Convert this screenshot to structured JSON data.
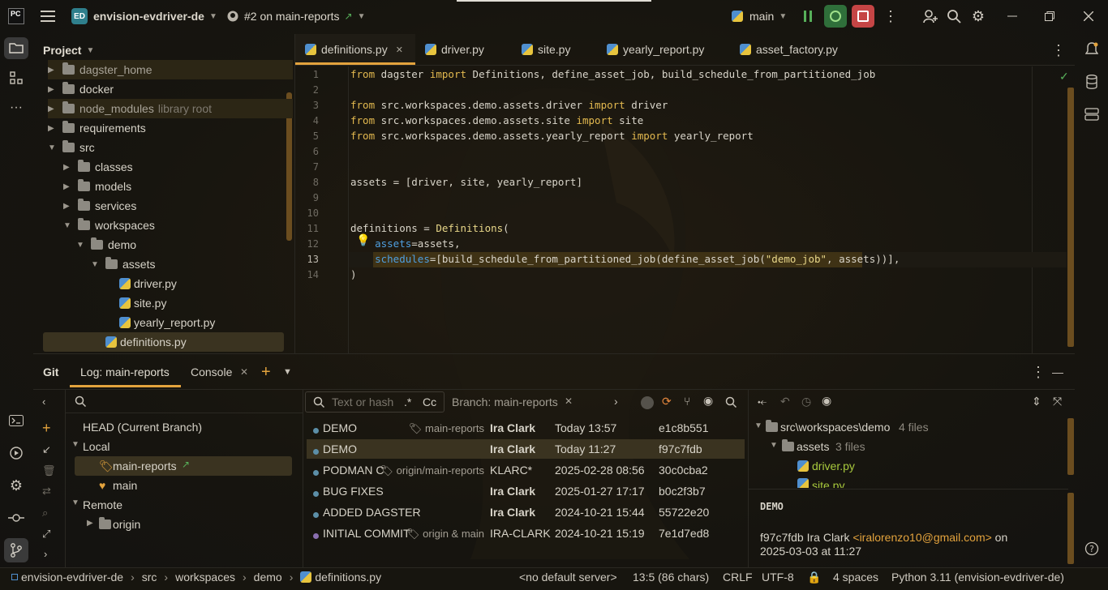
{
  "titlebar": {
    "app_icon": "PC",
    "project_badge": "ED",
    "project_name": "envision-evdriver-de",
    "pr_label": "#2 on main-reports",
    "branch": "main"
  },
  "tree": {
    "header": "Project",
    "items": [
      {
        "label": "dagster_home",
        "kind": "folder",
        "indent": 0,
        "arrow": "right"
      },
      {
        "label": "docker",
        "kind": "folder",
        "indent": 0,
        "arrow": "right"
      },
      {
        "label": "node_modules",
        "kind": "folder",
        "indent": 0,
        "arrow": "right",
        "note": "library root"
      },
      {
        "label": "requirements",
        "kind": "folder",
        "indent": 0,
        "arrow": "right"
      },
      {
        "label": "src",
        "kind": "folder",
        "indent": 0,
        "arrow": "down"
      },
      {
        "label": "classes",
        "kind": "folder",
        "indent": 1,
        "arrow": "right"
      },
      {
        "label": "models",
        "kind": "folder",
        "indent": 1,
        "arrow": "right"
      },
      {
        "label": "services",
        "kind": "folder",
        "indent": 1,
        "arrow": "right"
      },
      {
        "label": "workspaces",
        "kind": "folder",
        "indent": 1,
        "arrow": "down"
      },
      {
        "label": "demo",
        "kind": "folder",
        "indent": 2,
        "arrow": "down"
      },
      {
        "label": "assets",
        "kind": "folder",
        "indent": 3,
        "arrow": "down"
      },
      {
        "label": "driver.py",
        "kind": "py",
        "indent": 4,
        "arrow": ""
      },
      {
        "label": "site.py",
        "kind": "py",
        "indent": 4,
        "arrow": ""
      },
      {
        "label": "yearly_report.py",
        "kind": "py",
        "indent": 4,
        "arrow": ""
      },
      {
        "label": "definitions.py",
        "kind": "py",
        "indent": 3,
        "arrow": ""
      }
    ]
  },
  "editor": {
    "tabs": [
      "definitions.py",
      "driver.py",
      "site.py",
      "yearly_report.py",
      "asset_factory.py"
    ],
    "lines": [
      [
        [
          "kw",
          "from "
        ],
        [
          "",
          "dagster "
        ],
        [
          "kw",
          "import "
        ],
        [
          "",
          "Definitions, define_asset_job, build_schedule_from_partitioned_job"
        ]
      ],
      [],
      [
        [
          "kw",
          "from "
        ],
        [
          "",
          "src.workspaces.demo.assets.driver "
        ],
        [
          "kw",
          "import "
        ],
        [
          "",
          "driver"
        ]
      ],
      [
        [
          "kw",
          "from "
        ],
        [
          "",
          "src.workspaces.demo.assets.site "
        ],
        [
          "kw",
          "import "
        ],
        [
          "",
          "site"
        ]
      ],
      [
        [
          "kw",
          "from "
        ],
        [
          "",
          "src.workspaces.demo.assets.yearly_report "
        ],
        [
          "kw",
          "import "
        ],
        [
          "",
          "yearly_report"
        ]
      ],
      [],
      [],
      [
        [
          "",
          "assets = [driver, site, yearly_report]"
        ]
      ],
      [],
      [],
      [
        [
          "",
          "definitions = "
        ],
        [
          "fn",
          "Definitions"
        ],
        [
          "",
          "("
        ]
      ],
      [
        [
          "",
          "    "
        ],
        [
          "par",
          "assets"
        ],
        [
          "",
          "=assets,"
        ]
      ],
      [
        [
          "",
          "    "
        ],
        [
          "par",
          "schedules"
        ],
        [
          "",
          "=[build_schedule_from_partitioned_job(define_asset_job("
        ],
        [
          "str",
          "\"demo_job\""
        ],
        [
          "",
          ", assets))],"
        ]
      ],
      [
        [
          "",
          ")"
        ]
      ]
    ]
  },
  "bottom": {
    "tabs": [
      "Git",
      "Log: main-reports",
      "Console"
    ],
    "branches": {
      "head": "HEAD (Current Branch)",
      "local": "Local",
      "local_items": [
        "main-reports",
        "main"
      ],
      "remote": "Remote",
      "remote_items": [
        "origin"
      ]
    },
    "filter": {
      "placeholder": "Text or hash",
      "regex": ".*",
      "case": "Cc",
      "branch_label": "Branch: main-reports"
    },
    "commits": [
      {
        "msg": "DEMO",
        "tags": "main-reports",
        "author": "Ira Clark",
        "date": "Today 13:57",
        "hash": "e1c8b551"
      },
      {
        "msg": "DEMO",
        "tags": "",
        "author": "Ira Clark",
        "date": "Today 11:27",
        "hash": "f97c7fdb"
      },
      {
        "msg": "PODMAN C",
        "tags": "origin/main-reports",
        "author": "KLARC*",
        "date": "2025-02-28 08:56",
        "hash": "30c0cba2"
      },
      {
        "msg": "BUG FIXES",
        "tags": "",
        "author": "Ira Clark",
        "date": "2025-01-27 17:17",
        "hash": "b0c2f3b7"
      },
      {
        "msg": "ADDED DAGSTER",
        "tags": "",
        "author": "Ira Clark",
        "date": "2024-10-21 15:44",
        "hash": "55722e20"
      },
      {
        "msg": "INITIAL COMMIT",
        "tags": "origin & main",
        "author": "IRA-CLARK",
        "date": "2024-10-21 15:19",
        "hash": "7e1d7ed8"
      }
    ],
    "changes": {
      "root": "src\\workspaces\\demo",
      "root_count": "4 files",
      "folder": "assets",
      "folder_count": "3 files",
      "files": [
        "driver.py",
        "site.py"
      ]
    },
    "details": {
      "title": "DEMO",
      "line1_prefix": "f97c7fdb Ira Clark ",
      "email": "<iralorenzo10@gmail.com>",
      "line1_suffix": " on",
      "line2": "2025-03-03 at 11:27"
    }
  },
  "status": {
    "crumbs": [
      "envision-evdriver-de",
      "src",
      "workspaces",
      "demo",
      "definitions.py"
    ],
    "server": "<no default server>",
    "position": "13:5 (86 chars)",
    "line_sep": "CRLF",
    "encoding": "UTF-8",
    "indent": "4 spaces",
    "interpreter": "Python 3.11 (envision-evdriver-de)"
  },
  "colors": {
    "accent": "#e3a33d",
    "selection": "#3a3320",
    "keyword": "#e3b94f",
    "param": "#4f9fe0"
  }
}
